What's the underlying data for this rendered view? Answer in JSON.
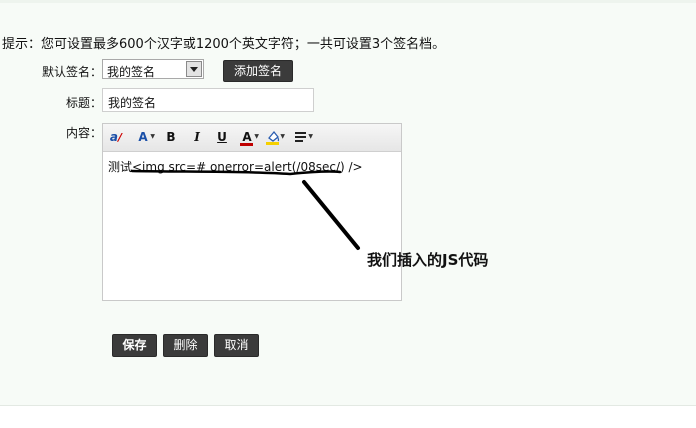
{
  "hint": "提示：您可设置最多600个汉字或1200个英文字符；一共可设置3个签名档。",
  "default_signature": {
    "label": "默认签名：",
    "selected": "我的签名",
    "add_button": "添加签名"
  },
  "title_field": {
    "label": "标题：",
    "value": "我的签名"
  },
  "content_field": {
    "label": "内容：",
    "editor_text": "测试<img src=# onerror=alert(/08sec/) />",
    "toolbar": [
      {
        "name": "spellcheck-icon",
        "glyph": "a"
      },
      {
        "name": "font-size-icon",
        "glyph": "A"
      },
      {
        "name": "bold-icon",
        "glyph": "B"
      },
      {
        "name": "italic-icon",
        "glyph": "I"
      },
      {
        "name": "underline-icon",
        "glyph": "U"
      },
      {
        "name": "font-color-icon",
        "glyph": "A"
      },
      {
        "name": "highlight-icon",
        "glyph": "◇"
      },
      {
        "name": "align-icon",
        "glyph": "≡"
      }
    ]
  },
  "annotation": "我们插入的JS代码",
  "actions": {
    "save": "保存",
    "delete": "删除",
    "cancel": "取消"
  },
  "colors": {
    "panel_bg": "#f7fbf7",
    "button_dark": "#3b3b3b",
    "font_color_bar": "#c00000",
    "highlight_bar": "#f5d000"
  }
}
